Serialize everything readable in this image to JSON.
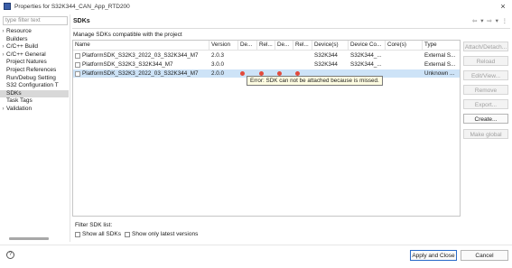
{
  "window": {
    "title": "Properties for S32K344_CAN_App_RTD200",
    "close_glyph": "×"
  },
  "filter": {
    "placeholder": "type filter text"
  },
  "nav": {
    "items": [
      {
        "label": "Resource",
        "expand": true,
        "selected": false
      },
      {
        "label": "Builders",
        "expand": false,
        "selected": false
      },
      {
        "label": "C/C++ Build",
        "expand": true,
        "selected": false
      },
      {
        "label": "C/C++ General",
        "expand": true,
        "selected": false
      },
      {
        "label": "Project Natures",
        "expand": false,
        "selected": false
      },
      {
        "label": "Project References",
        "expand": false,
        "selected": false
      },
      {
        "label": "Run/Debug Setting",
        "expand": false,
        "selected": false
      },
      {
        "label": "S32 Configuration T",
        "expand": false,
        "selected": false
      },
      {
        "label": "SDKs",
        "expand": false,
        "selected": true
      },
      {
        "label": "Task Tags",
        "expand": false,
        "selected": false
      },
      {
        "label": "Validation",
        "expand": true,
        "selected": false
      }
    ]
  },
  "page": {
    "title": "SDKs",
    "nav_glyphs": "⇦ ▾ ⇨ ▾ ⋮",
    "description": "Manage SDKs compatible with the project"
  },
  "table": {
    "columns": [
      "Name",
      "Version",
      "De...",
      "Rel...",
      "De...",
      "Rel...",
      "Device(s)",
      "Device Co...",
      "Core(s)",
      "Type"
    ],
    "rows": [
      {
        "name": "PlatformSDK_S32K3_2022_03_S32K344_M7",
        "version": "2.0.3",
        "device": "S32K344",
        "device_co": "S32K344_...",
        "core": "",
        "type": "External S...",
        "errors": false,
        "selected": false
      },
      {
        "name": "PlatformSDK_S32K3_S32K344_M7",
        "version": "3.0.0",
        "device": "S32K344",
        "device_co": "S32K344_...",
        "core": "",
        "type": "External S...",
        "errors": false,
        "selected": false
      },
      {
        "name": "PlatformSDK_S32K3_2022_03_S32K344_M7",
        "version": "2.0.0",
        "device": "",
        "device_co": "",
        "core": "",
        "type": "Unknown ...",
        "errors": true,
        "selected": true
      }
    ],
    "tooltip": "Error: SDK can not be attached because is missed."
  },
  "side_buttons": [
    {
      "label": "Attach/Detach...",
      "enabled": false
    },
    {
      "label": "Reload",
      "enabled": false
    },
    {
      "label": "Edit/View...",
      "enabled": false
    },
    {
      "label": "Remove",
      "enabled": false
    },
    {
      "label": "Export...",
      "enabled": false
    },
    {
      "label": "Create...",
      "enabled": true
    },
    {
      "label": "Make global",
      "enabled": false
    }
  ],
  "filter_sdk": {
    "label": "Filter SDK list:",
    "show_all": "Show all SDKs",
    "show_latest": "Show only latest versions"
  },
  "bottom": {
    "help": "?",
    "apply_close": "Apply and Close",
    "cancel": "Cancel"
  },
  "colors": {
    "selected_row": "#cde3f7",
    "error": "#e24a3b",
    "primary_border": "#2a6bc8"
  }
}
